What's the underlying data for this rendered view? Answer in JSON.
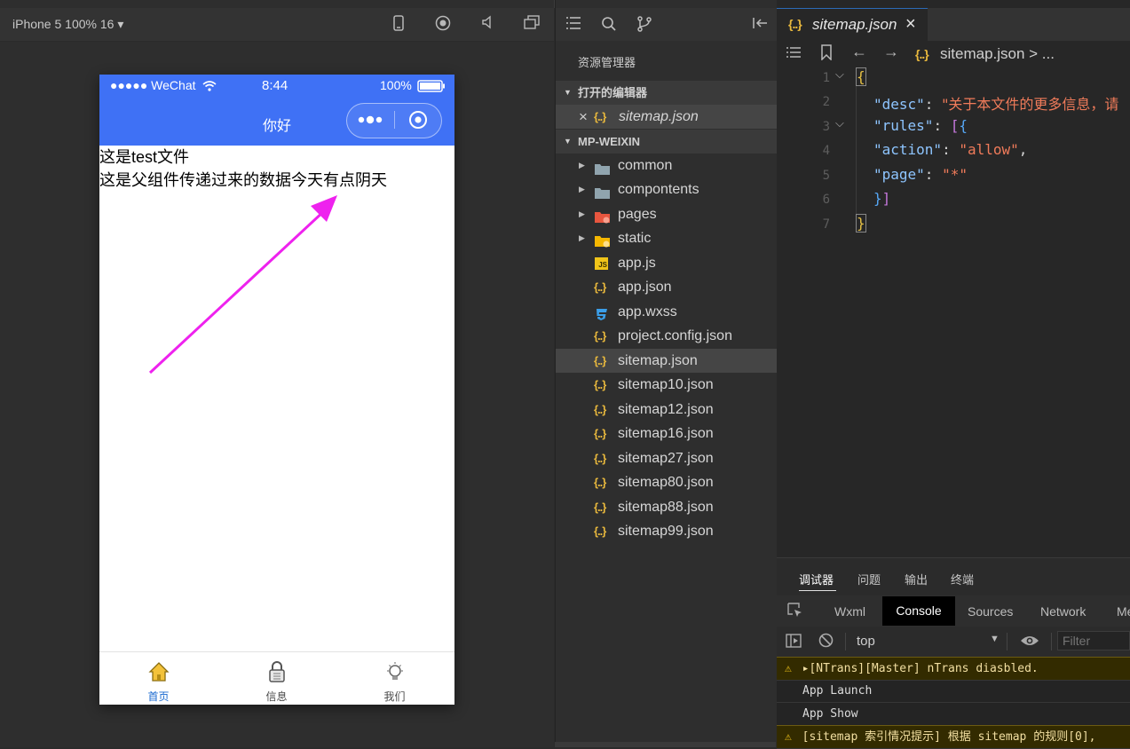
{
  "simulator": {
    "device_label": "iPhone 5 100% 16 ▾",
    "status_bar": {
      "carrier": "●●●●● WeChat",
      "time": "8:44",
      "battery": "100%"
    },
    "nav_title": "你好",
    "content_lines": [
      "这是test文件",
      "这是父组件传递过来的数据今天有点阴天"
    ],
    "tabs": [
      {
        "label": "首页",
        "active": true
      },
      {
        "label": "信息",
        "active": false
      },
      {
        "label": "我们",
        "active": false
      }
    ],
    "colors": {
      "nav_bar": "#3f71f5",
      "tab_active": "#1a6ad0",
      "tab_inactive": "#4a4a4a",
      "annotation_arrow": "#ee22ee"
    }
  },
  "explorer": {
    "title": "资源管理器",
    "open_editors_label": "打开的编辑器",
    "open_editor_file": "sitemap.json",
    "project_label": "MP-WEIXIN",
    "folders": [
      "common",
      "compontents",
      "pages",
      "static"
    ],
    "files": [
      {
        "name": "app.js",
        "icon": "js-icon"
      },
      {
        "name": "app.json",
        "icon": "json-icon"
      },
      {
        "name": "app.wxss",
        "icon": "css-icon"
      },
      {
        "name": "project.config.json",
        "icon": "json-icon"
      },
      {
        "name": "sitemap.json",
        "icon": "json-icon",
        "selected": true
      },
      {
        "name": "sitemap10.json",
        "icon": "json-icon"
      },
      {
        "name": "sitemap12.json",
        "icon": "json-icon"
      },
      {
        "name": "sitemap16.json",
        "icon": "json-icon"
      },
      {
        "name": "sitemap27.json",
        "icon": "json-icon"
      },
      {
        "name": "sitemap80.json",
        "icon": "json-icon"
      },
      {
        "name": "sitemap88.json",
        "icon": "json-icon"
      },
      {
        "name": "sitemap99.json",
        "icon": "json-icon"
      }
    ]
  },
  "editor": {
    "tab_label": "sitemap.json",
    "breadcrumb": "sitemap.json > ...",
    "line_numbers": [
      "1",
      "2",
      "3",
      "4",
      "5",
      "6",
      "7"
    ],
    "code": {
      "open_brace": "{",
      "desc_key": "\"desc\"",
      "desc_value": "\"关于本文件的更多信息，请",
      "rules_key": "\"rules\"",
      "action_key": "\"action\"",
      "action_value": "\"allow\"",
      "page_key": "\"page\"",
      "page_value": "\"*\"",
      "close_brace": "}"
    }
  },
  "debugger": {
    "tabs": [
      "调试器",
      "问题",
      "输出",
      "终端"
    ],
    "subtabs": [
      "Wxml",
      "Console",
      "Sources",
      "Network",
      "Me"
    ],
    "context": "top",
    "filter_placeholder": "Filter",
    "messages": [
      {
        "text": "▸[NTrans][Master] nTrans diasbled.",
        "level": "warn"
      },
      {
        "text": "App Launch",
        "level": "log"
      },
      {
        "text": "App Show",
        "level": "log"
      },
      {
        "text": "[sitemap 索引情况提示] 根据 sitemap 的规则[0],",
        "level": "warn"
      }
    ]
  }
}
